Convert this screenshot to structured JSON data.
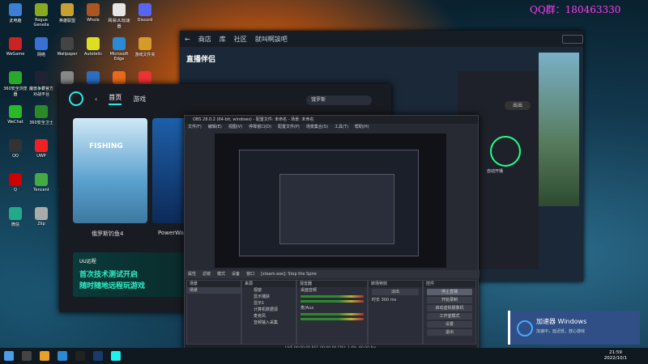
{
  "watermark": "QQ群：180463330",
  "desktop_icons": [
    {
      "label": "此电脑",
      "color": "#3b7fd6"
    },
    {
      "label": "WeGame",
      "color": "#cc2222"
    },
    {
      "label": "360安全浏览器",
      "color": "#2aa82a"
    },
    {
      "label": "WeChat",
      "color": "#2ab82a"
    },
    {
      "label": "QQ",
      "color": "#333"
    },
    {
      "label": "Q",
      "color": "#c00"
    },
    {
      "label": "微信",
      "color": "#2a8"
    },
    {
      "label": "Rogue Geneila",
      "color": "#8a2"
    },
    {
      "label": "网络",
      "color": "#3a6fd6"
    },
    {
      "label": "魔兽争霸官方对战平台",
      "color": "#223"
    },
    {
      "label": "360安全卫士",
      "color": "#2a8a2a"
    },
    {
      "label": "UWP",
      "color": "#e22"
    },
    {
      "label": "Tencent",
      "color": "#4a4"
    },
    {
      "label": "Zlip",
      "color": "#aaa"
    },
    {
      "label": "英雄联盟",
      "color": "#c8a030"
    },
    {
      "label": "Wallpaper",
      "color": "#444"
    },
    {
      "label": "回收站",
      "color": "#888"
    },
    {
      "label": "说话VPN",
      "color": "#555"
    },
    {
      "label": "1234",
      "color": "#6a6"
    },
    {
      "label": "PlateUp!",
      "color": "#eee"
    },
    {
      "label": "直播伴侣",
      "color": "#e44"
    },
    {
      "label": "Whole",
      "color": "#a52"
    },
    {
      "label": "Autotelic",
      "color": "#dd2"
    },
    {
      "label": "控制面板",
      "color": "#2a6fc6"
    },
    {
      "label": "任务管理器",
      "color": "#c22"
    },
    {
      "label": "EPIC",
      "color": "#222"
    },
    {
      "label": "腾讯会议",
      "color": "#2a7fe0"
    },
    {
      "label": "OBS Studio",
      "color": "#222"
    },
    {
      "label": "网易UU加速器",
      "color": "#e6e6e6"
    },
    {
      "label": "Microsoft Edge",
      "color": "#2a8ad6"
    },
    {
      "label": "Origin",
      "color": "#e86a1a"
    },
    {
      "label": "微信",
      "color": "#2ab82a"
    },
    {
      "label": "Steam",
      "color": "#1a3a6a"
    },
    {
      "label": "海龟汤",
      "color": "#2a6"
    },
    {
      "label": "猫咪",
      "color": "#a8d"
    },
    {
      "label": "Discord",
      "color": "#5865f2"
    },
    {
      "label": "游戏文件夹",
      "color": "#d49a2a"
    },
    {
      "label": "SDM",
      "color": "#e33"
    }
  ],
  "steam": {
    "nav": [
      "商店",
      "库",
      "社区",
      "就叫啊誒吧"
    ],
    "logo": "直播伴侣",
    "account": "账户"
  },
  "ccbox": {
    "out": "出出",
    "circle": "自动开播",
    "small": "开始直播"
  },
  "cc": {
    "tabs": [
      "首页",
      "游戏"
    ],
    "search": "饿罗斯",
    "cards": [
      "俄罗斯钓鱼4",
      "PowerWash"
    ],
    "banner_brand": "UU远程",
    "banner_line1": "首次技术测试开启",
    "banner_line2": "随时随地远程玩游戏"
  },
  "obs": {
    "title": "OBS 28.0.2 (64-bit, windows) - 配置文件: 未命名 - 场景: 未命名",
    "menu": [
      "文件(F)",
      "编辑(E)",
      "视图(V)",
      "停靠窗口(D)",
      "配置文件(P)",
      "场景集合(S)",
      "工具(T)",
      "帮助(H)"
    ],
    "toolbar": [
      "属性",
      "滤镜",
      "模式",
      "设备",
      "窗口",
      "[steam.exe]: Stop the Spire"
    ],
    "docks": {
      "scenes": "场景",
      "sources": "来源",
      "mixer": "混音器",
      "transitions": "转场特效",
      "controls": "控件"
    },
    "scene_item": "场景",
    "sources": [
      "视窗",
      "显示捕获",
      "显示1",
      "计算机数据源",
      "麦克风",
      "音频输入采集"
    ],
    "mixer_labels": [
      "桌面音频",
      "麦/Aux"
    ],
    "trans_mode": "淡出",
    "trans_dur_label": "时长",
    "trans_dur": "300 ms",
    "controls": [
      "停止直播",
      "开始录制",
      "启动虚拟摄像机",
      "工作室模式",
      "设置",
      "退出"
    ],
    "status": "LIVE 00:00:00  REC 00:00:00  CPU: 1.4%, 60.00 fps"
  },
  "notif": {
    "title": "加速器 Windows",
    "sub": "加速中，延迟低，放心游戏"
  },
  "clock": {
    "time": "21:59",
    "date": "2022/10/1"
  }
}
